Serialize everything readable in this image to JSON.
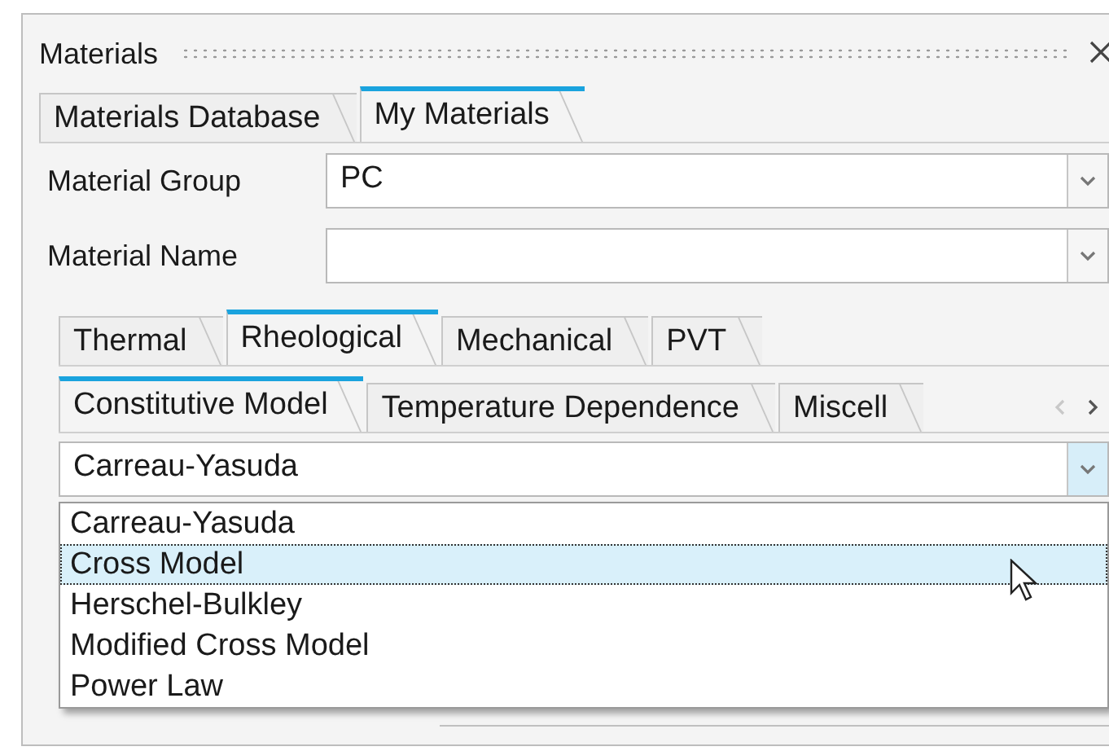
{
  "panel": {
    "title": "Materials"
  },
  "tabs": [
    {
      "label": "Materials Database",
      "selected": false
    },
    {
      "label": "My Materials",
      "selected": true
    }
  ],
  "fields": [
    {
      "label": "Material Group",
      "value": "PC",
      "open": false
    },
    {
      "label": "Material Name",
      "open": false
    }
  ],
  "property_tabs": [
    {
      "label": "Thermal",
      "selected": false
    },
    {
      "label": "Rheological",
      "selected": true
    },
    {
      "label": "Mechanical",
      "selected": false
    },
    {
      "label": "PVT",
      "selected": false
    }
  ],
  "sub_tabs": [
    {
      "label": "Constitutive Model",
      "selected": true
    },
    {
      "label": "Temperature Dependence",
      "selected": false
    },
    {
      "label": "Miscell",
      "selected": false
    }
  ],
  "sub_tab_scroll": {
    "left_disabled": true,
    "right_disabled": false
  },
  "model_combo": {
    "value": "Carreau-Yasuda",
    "open": true
  },
  "model_options": [
    {
      "label": "Carreau-Yasuda",
      "selected": false
    },
    {
      "label": "Cross Model",
      "selected": true
    },
    {
      "label": "Herschel-Bulkley",
      "selected": false
    },
    {
      "label": "Modified Cross Model",
      "selected": false
    },
    {
      "label": "Power Law",
      "selected": false
    }
  ]
}
